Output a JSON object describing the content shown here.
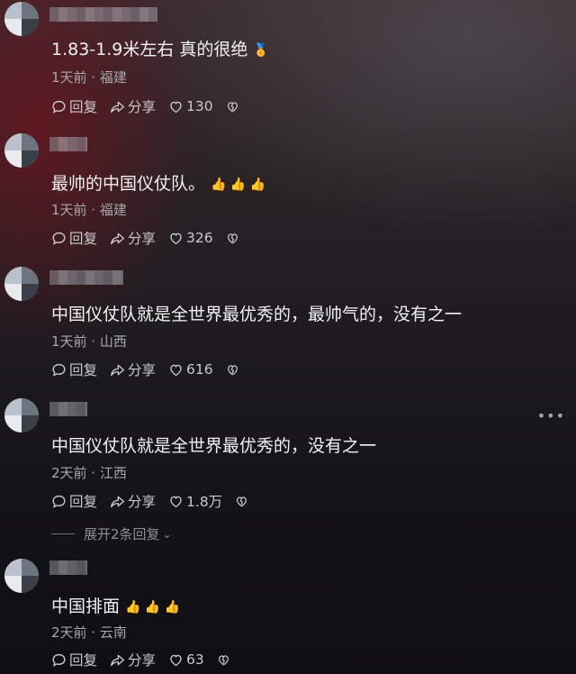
{
  "comments": [
    {
      "text": "1.83-1.9米左右 真的很绝",
      "emoji": "🏅",
      "meta": "1天前 · 福建",
      "reply_label": "回复",
      "share_label": "分享",
      "likes": "130"
    },
    {
      "text": "最帅的中国仪仗队。",
      "emoji": "👍 👍 👍",
      "meta": "1天前 · 福建",
      "reply_label": "回复",
      "share_label": "分享",
      "likes": "326"
    },
    {
      "text": "中国仪仗队就是全世界最优秀的，最帅气的，没有之一",
      "emoji": "",
      "meta": "1天前 · 山西",
      "reply_label": "回复",
      "share_label": "分享",
      "likes": "616"
    },
    {
      "text": "中国仪仗队就是全世界最优秀的，没有之一",
      "emoji": "",
      "meta": "2天前 · 江西",
      "reply_label": "回复",
      "share_label": "分享",
      "likes": "1.8万"
    },
    {
      "text": "中国排面",
      "emoji": "👍 👍 👍",
      "meta": "2天前 · 云南",
      "reply_label": "回复",
      "share_label": "分享",
      "likes": "63"
    }
  ],
  "more_icon": "more-dots-icon",
  "expand_replies": "展开2条回复",
  "icons": {
    "reply": "reply-bubble-icon",
    "share": "share-arrow-icon",
    "like": "heart-icon",
    "dislike": "broken-heart-icon"
  }
}
